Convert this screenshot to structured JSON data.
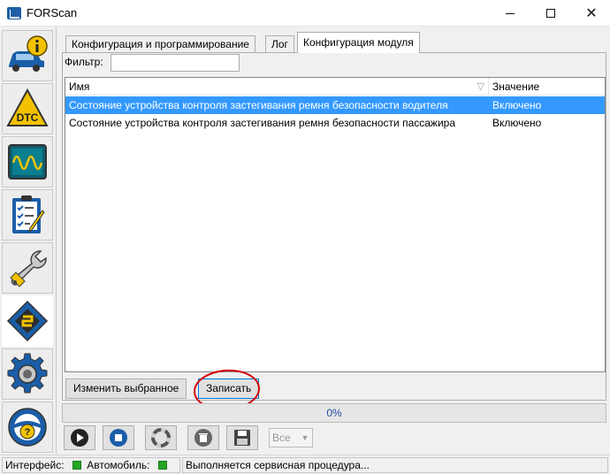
{
  "window": {
    "title": "FORScan",
    "close_glyph": "✕"
  },
  "sidebar": {
    "items": [
      {
        "name": "vehicle-info",
        "icon": "car-info-icon",
        "active": false
      },
      {
        "name": "dtc",
        "icon": "dtc-icon",
        "label": "DTC",
        "active": false
      },
      {
        "name": "oscilloscope",
        "icon": "oscilloscope-icon",
        "active": false
      },
      {
        "name": "tests",
        "icon": "checklist-icon",
        "active": false
      },
      {
        "name": "service",
        "icon": "wrench-icon",
        "active": false
      },
      {
        "name": "configuration",
        "icon": "chip-icon",
        "active": true
      },
      {
        "name": "settings",
        "icon": "gear-icon",
        "active": false
      },
      {
        "name": "help",
        "icon": "help-wheel-icon",
        "label": "?",
        "active": false
      }
    ]
  },
  "tabs": [
    {
      "label": "Конфигурация и программирование",
      "active": false
    },
    {
      "label": "Лог",
      "active": false
    },
    {
      "label": "Конфигурация модуля",
      "active": true
    }
  ],
  "filter": {
    "label": "Фильтр:",
    "value": "",
    "placeholder": ""
  },
  "table": {
    "columns": {
      "name": "Имя",
      "value": "Значение"
    },
    "sort_glyph": "▽",
    "rows": [
      {
        "name": "Состояние устройства контроля застегивания ремня безопасности водителя",
        "value": "Включено",
        "selected": true
      },
      {
        "name": "Состояние устройства контроля застегивания ремня безопасности пассажира",
        "value": "Включено",
        "selected": false
      }
    ]
  },
  "buttons": {
    "edit_selected": "Изменить выбранное",
    "write": "Записать"
  },
  "progress": {
    "percent": 0,
    "text": "0%"
  },
  "toolbar": {
    "items": [
      "play-icon",
      "stop-icon",
      "lifebuoy-icon",
      "delete-icon",
      "save-icon"
    ],
    "combo_value": "Все"
  },
  "status": {
    "interface_label": "Интерфейс:",
    "vehicle_label": "Автомобиль:",
    "message": "Выполняется сервисная процедура..."
  },
  "colors": {
    "selection": "#3399ff",
    "led": "#23a523",
    "annotation": "#d40000",
    "progress_text": "#1f4a9e"
  }
}
